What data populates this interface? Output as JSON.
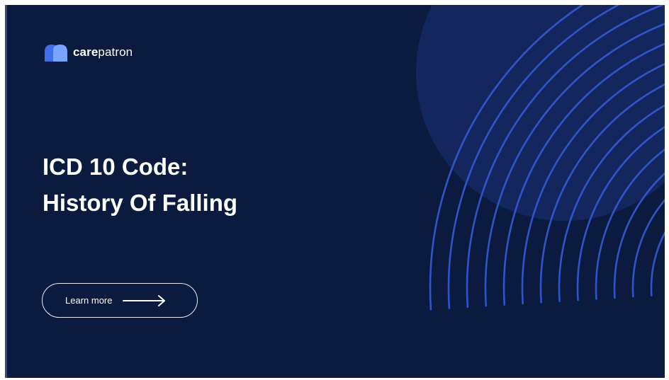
{
  "brand": {
    "name_bold": "care",
    "name_regular": "patron",
    "logo_icon": "carepatron-logo-icon"
  },
  "hero": {
    "title_line1": "ICD 10 Code:",
    "title_line2": "History Of Falling"
  },
  "cta": {
    "label": "Learn more",
    "icon": "arrow-right-icon"
  },
  "colors": {
    "background": "#0b1a3f",
    "circle": "#13275e",
    "arcs": "#2f55c8",
    "logo_blue": "#4a7df0",
    "text": "#ffffff"
  }
}
